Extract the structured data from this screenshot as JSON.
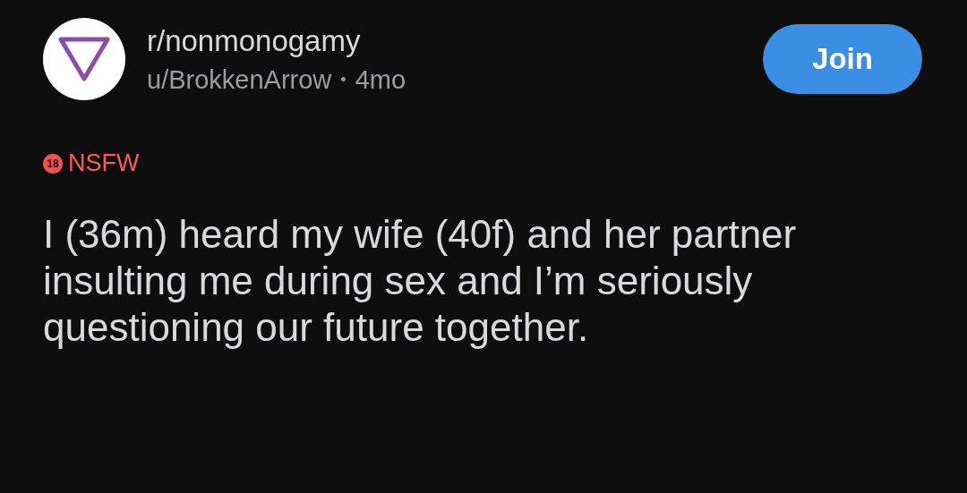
{
  "community": {
    "name": "r/nonmonogamy",
    "author": "u/BrokkenArrow",
    "separator": "•",
    "age": "4mo"
  },
  "join_button": "Join",
  "nsfw": {
    "badge": "18",
    "label": "NSFW"
  },
  "title": "I (36m) heard my wife (40f) and her partner insulting me during sex and I’m seriously questioning our future together."
}
